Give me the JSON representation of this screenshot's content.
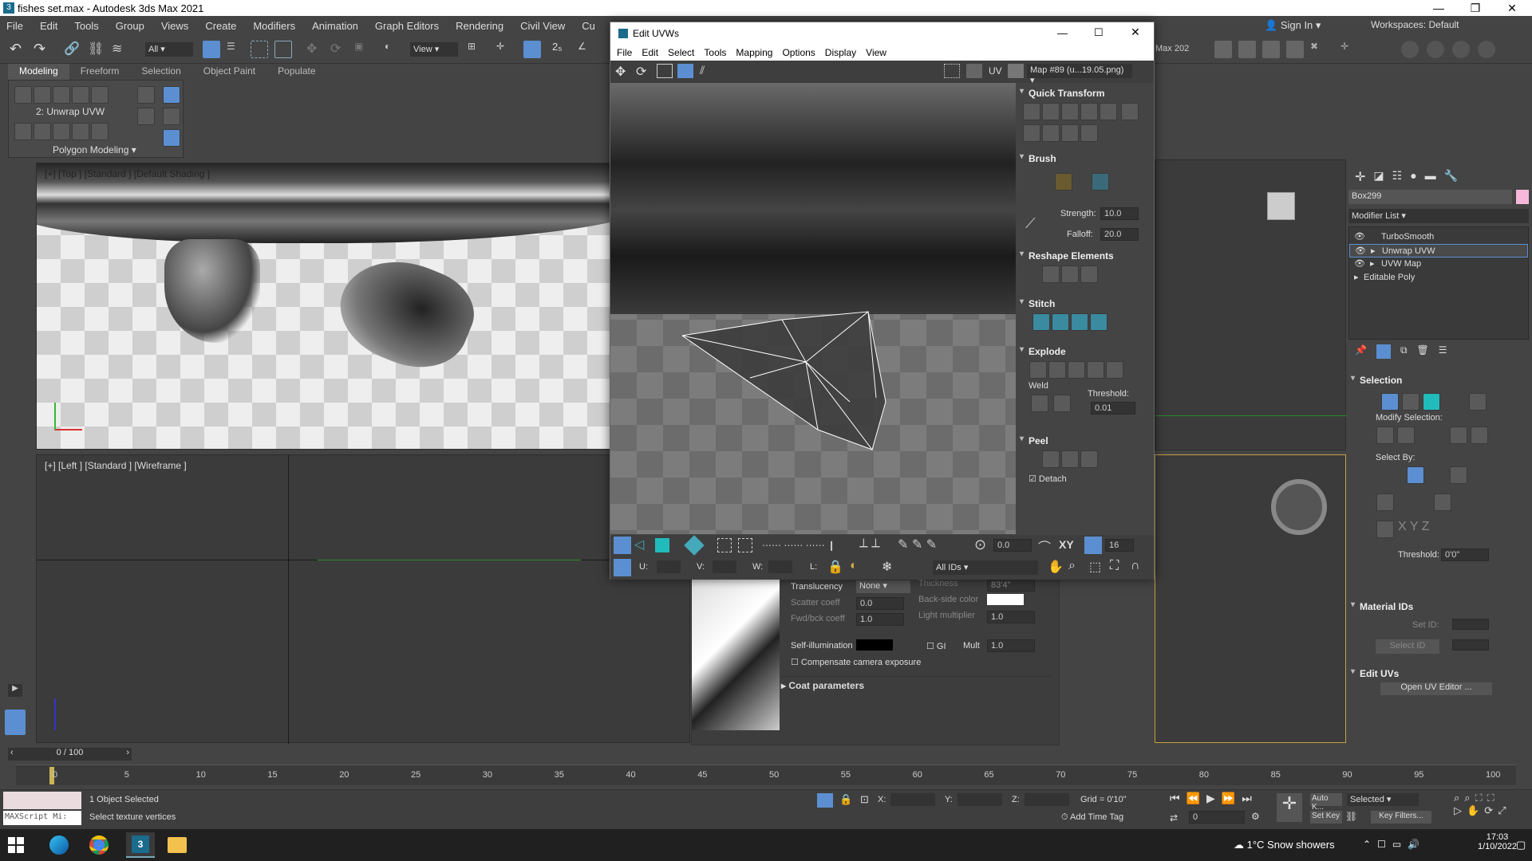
{
  "app": {
    "title": "fishes set.max - Autodesk 3ds Max 2021"
  },
  "menu": [
    "File",
    "Edit",
    "Tools",
    "Group",
    "Views",
    "Create",
    "Modifiers",
    "Animation",
    "Graph Editors",
    "Rendering",
    "Civil View",
    "Cu"
  ],
  "toolbar": {
    "selection_filter": "All",
    "ref_coord": "View",
    "workspace_label": "Workspaces:",
    "workspace_value": "Default",
    "sign_in": "Sign In",
    "max_badge": "Max 202"
  },
  "ribbon": {
    "tabs": [
      "Modeling",
      "Freeform",
      "Selection",
      "Object Paint",
      "Populate"
    ],
    "modifier_label": "2: Unwrap UVW",
    "section": "Polygon Modeling"
  },
  "viewport_top": {
    "label": "[+] [Top ] [Standard ] [Default Shading ]"
  },
  "viewport_left": {
    "label": "[+] [Left ] [Standard ] [Wireframe ]"
  },
  "uvw": {
    "title": "Edit UVWs",
    "menu": [
      "File",
      "Edit",
      "Select",
      "Tools",
      "Mapping",
      "Options",
      "Display",
      "View"
    ],
    "uv_label": "UV",
    "map_select": "Map #89 (u...19.05.png)",
    "panels": {
      "quick_transform": "Quick Transform",
      "brush": "Brush",
      "strength_label": "Strength:",
      "strength_value": "10.0",
      "falloff_label": "Falloff:",
      "falloff_value": "20.0",
      "reshape": "Reshape Elements",
      "stitch": "Stitch",
      "explode": "Explode",
      "weld": "Weld",
      "threshold_label": "Threshold:",
      "threshold_value": "0.01",
      "peel": "Peel",
      "detach": "Detach"
    },
    "bottom": {
      "rotate_value": "0.0",
      "xy_label": "XY",
      "grid_value": "16",
      "u_label": "U:",
      "v_label": "V:",
      "w_label": "W:",
      "l_label": "L:",
      "ids_select": "All IDs"
    }
  },
  "material": {
    "translucency_label": "Translucency",
    "translucency_value": "None",
    "thickness_label": "Thickness",
    "thickness_value": "83'4\"",
    "scatter_label": "Scatter coeff",
    "scatter_value": "0.0",
    "backside_label": "Back-side color",
    "fwd_label": "Fwd/bck coeff",
    "fwd_value": "1.0",
    "light_label": "Light multiplier",
    "light_value": "1.0",
    "selfillum_label": "Self-illumination",
    "gi_label": "GI",
    "mult_label": "Mult",
    "mult_value": "1.0",
    "compensate_label": "Compensate camera exposure",
    "coat_label": "Coat parameters"
  },
  "command_panel": {
    "object_name": "Box299",
    "modifier_list": "Modifier List",
    "stack": [
      "TurboSmooth",
      "Unwrap UVW",
      "UVW Map",
      "Editable Poly"
    ],
    "selection_title": "Selection",
    "modify_selection": "Modify Selection:",
    "select_by": "Select By:",
    "threshold_label": "Threshold:",
    "threshold_value": "0'0\"",
    "material_ids": "Material IDs",
    "set_id": "Set ID:",
    "select_id": "Select ID",
    "edit_uvs": "Edit UVs",
    "open_uv": "Open UV Editor ..."
  },
  "timeline": {
    "frame": "0 / 100",
    "ticks": [
      "0",
      "5",
      "10",
      "15",
      "20",
      "25",
      "30",
      "35",
      "40",
      "45",
      "50",
      "55",
      "60",
      "65",
      "70",
      "75",
      "80",
      "85",
      "90",
      "95",
      "100"
    ]
  },
  "status": {
    "maxscript": "MAXScript Mi:",
    "selected_count": "1 Object Selected",
    "prompt": "Select texture vertices",
    "x_label": "X:",
    "y_label": "Y:",
    "z_label": "Z:",
    "grid": "Grid = 0'10\"",
    "add_time_tag": "Add Time Tag",
    "autokey": "Auto K...",
    "selected_dd": "Selected",
    "set_key": "Set Key",
    "key_filters": "Key Filters...",
    "frame_value": "0"
  },
  "taskbar": {
    "weather": "1°C  Snow showers",
    "time": "17:03",
    "date": "1/10/2022"
  }
}
